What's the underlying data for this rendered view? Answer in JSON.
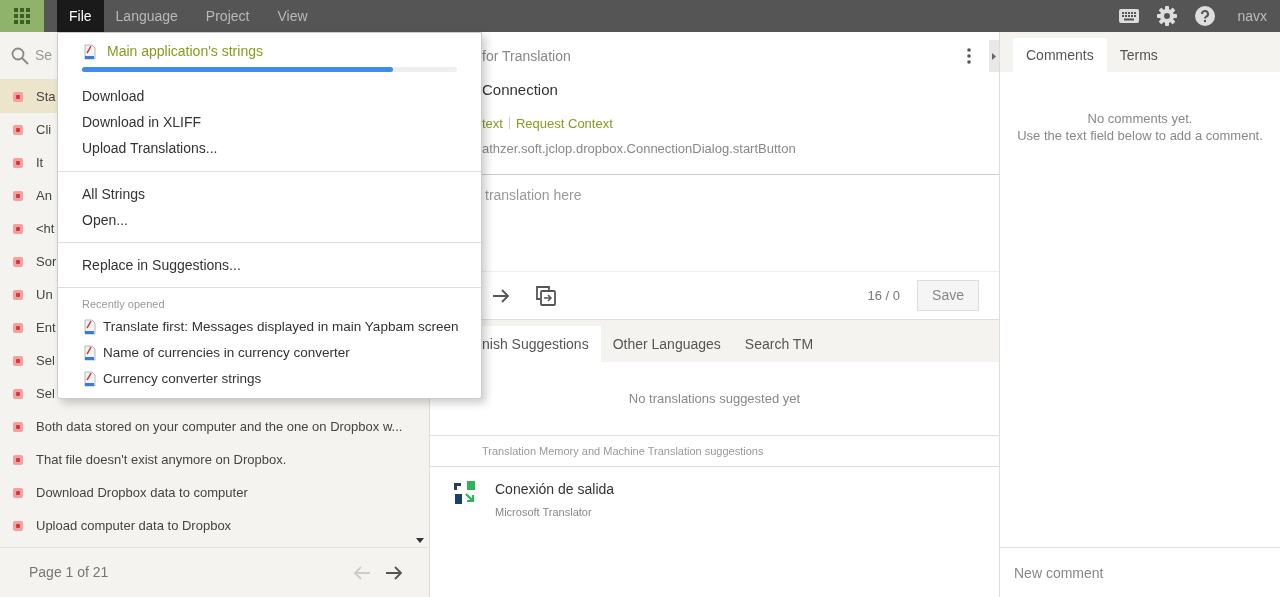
{
  "menubar": {
    "items": [
      {
        "label": "File",
        "selected": true
      },
      {
        "label": "Language",
        "selected": false
      },
      {
        "label": "Project",
        "selected": false
      },
      {
        "label": "View",
        "selected": false
      }
    ],
    "user": "navx"
  },
  "left_panel": {
    "search": {
      "placeholder": "Se"
    },
    "strings": [
      {
        "text": "Sta",
        "selected": true
      },
      {
        "text": "Cli",
        "selected": false
      },
      {
        "text": "It",
        "selected": false
      },
      {
        "text": "An",
        "selected": false
      },
      {
        "text": "<ht",
        "selected": false
      },
      {
        "text": "Sor",
        "selected": false
      },
      {
        "text": "Un",
        "selected": false
      },
      {
        "text": "Ent",
        "selected": false
      },
      {
        "text": "Sel",
        "selected": false
      },
      {
        "text": "Sel",
        "selected": false
      },
      {
        "text": "Both data stored on your computer and the one on Dropbox w...",
        "selected": false
      },
      {
        "text": "That file doesn't exist anymore on Dropbox.",
        "selected": false
      },
      {
        "text": "Download Dropbox data to computer",
        "selected": false
      },
      {
        "text": "Upload computer data to Dropbox",
        "selected": false
      }
    ],
    "pager": {
      "label": "Page 1 of 21",
      "prev": {
        "disabled": true
      },
      "next": {
        "disabled": false
      }
    }
  },
  "file_menu": {
    "project": {
      "title": "Main application's strings",
      "level": 0.83
    },
    "sections": [
      [
        "Download",
        "Download in XLIFF",
        "Upload Translations..."
      ],
      [
        "All Strings",
        "Open..."
      ],
      [
        "Replace in Suggestions..."
      ]
    ],
    "recent": {
      "heading": "Recently opened",
      "items": [
        "Translate first: Messages displayed in main Yapbam screen",
        "Name of currencies in currency converter",
        "Currency converter strings"
      ]
    }
  },
  "editor": {
    "status": "for Translation",
    "source": "Connection",
    "links": [
      "text",
      "Request Context"
    ],
    "key": "athzer.soft.jclop.dropbox.ConnectionDialog.startButton",
    "translation": {
      "placeholder": "translation here"
    },
    "counter": "16 / 0",
    "save": "Save",
    "tabs": [
      {
        "label": "nish Suggestions",
        "selected": true
      },
      {
        "label": "Other Languages",
        "selected": false
      },
      {
        "label": "Search TM",
        "selected": false
      }
    ],
    "empty_message": "No translations suggested yet",
    "section_heading": "Translation Memory and Machine Translation suggestions",
    "suggestions": [
      {
        "text": "Conexión de salida",
        "source": "Microsoft Translator"
      }
    ]
  },
  "right_panel": {
    "tabs": [
      {
        "label": "Comments",
        "selected": true
      },
      {
        "label": "Terms",
        "selected": false
      }
    ],
    "empty_message": [
      "No comments yet.",
      "Use the text field below to add a comment."
    ],
    "new_comment": {
      "placeholder": "New comment"
    }
  }
}
